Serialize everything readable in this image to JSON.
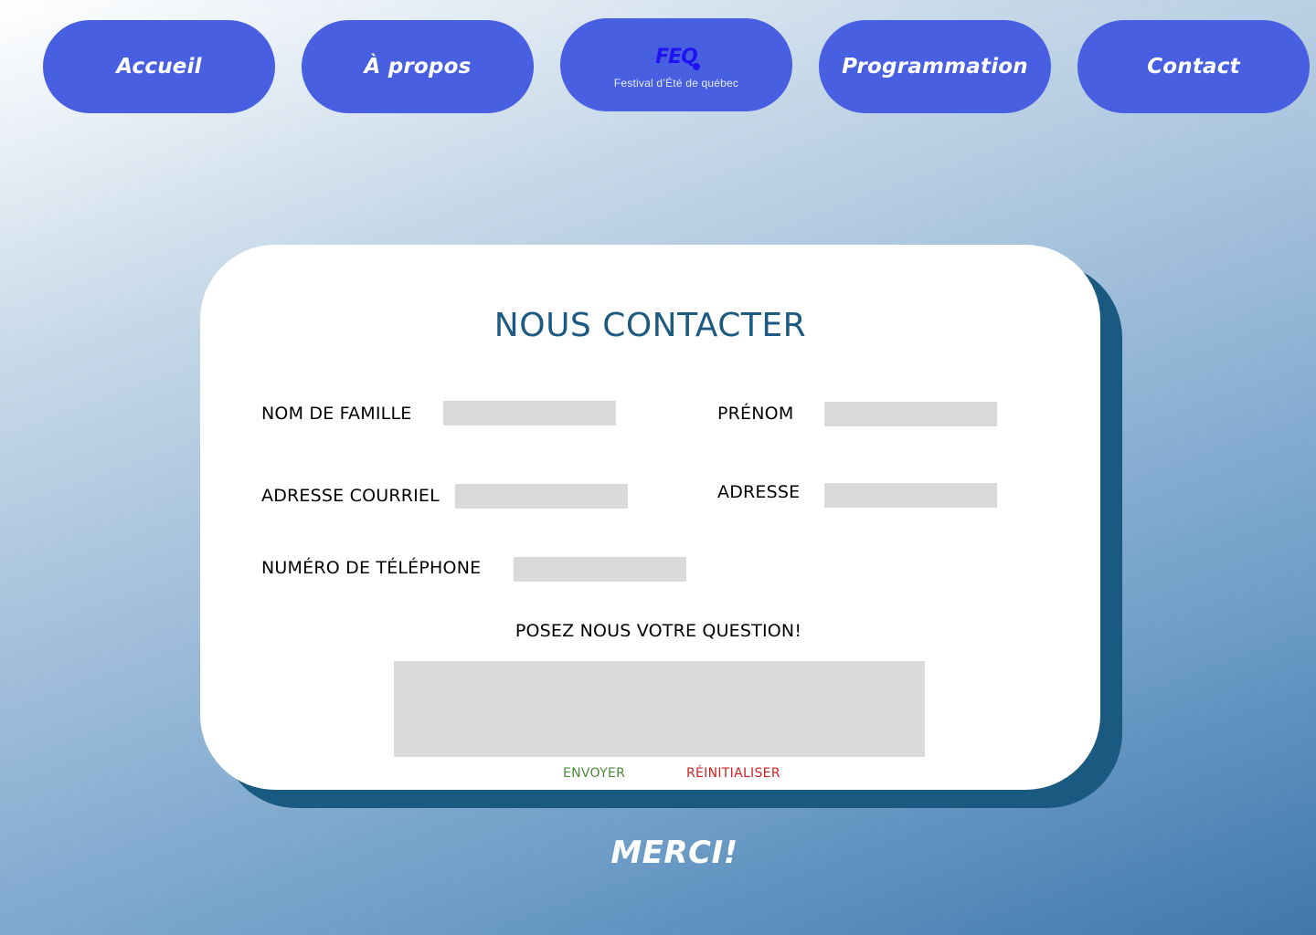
{
  "nav": {
    "home_label": "Accueil",
    "about_label": "À propos",
    "logo": {
      "mark": "FEQ",
      "subtitle": "Festival d’Été de québec"
    },
    "program_label": "Programmation",
    "contact_label": "Contact"
  },
  "form": {
    "title": "NOUS CONTACTER",
    "last_name_label": "NOM DE FAMILLE",
    "first_name_label": "PRÉNOM",
    "email_label": "ADRESSE COURRIEL",
    "address_label": "ADRESSE",
    "phone_label": "NUMÉRO DE TÉLÉPHONE",
    "question_label": "POSEZ NOUS VOTRE QUESTION!",
    "send_label": "ENVOYER",
    "reset_label": "RÉINITIALISER"
  },
  "footer": {
    "thanks": "MERCI!"
  },
  "colors": {
    "nav_button": "#485fe1",
    "logo": "#2013f0",
    "title": "#1d5a82",
    "card_shadow": "#1b5a80",
    "field": "#d9d9d9",
    "send": "#4a8a3a",
    "reset": "#d01f1f"
  }
}
